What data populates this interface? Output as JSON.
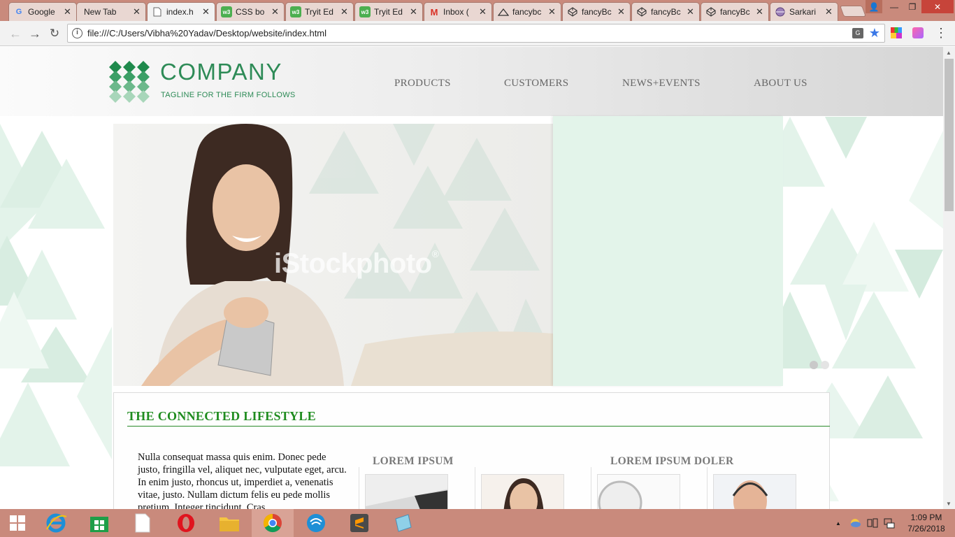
{
  "browser": {
    "tabs": [
      {
        "label": "Google",
        "icon": "google-icon"
      },
      {
        "label": "New Tab",
        "icon": ""
      },
      {
        "label": "index.h",
        "icon": "page-icon",
        "active": true
      },
      {
        "label": "CSS bo",
        "icon": "w3-icon"
      },
      {
        "label": "Tryit Ed",
        "icon": "w3-icon"
      },
      {
        "label": "Tryit Ed",
        "icon": "w3-icon"
      },
      {
        "label": "Inbox (",
        "icon": "gmail-icon"
      },
      {
        "label": "fancybc",
        "icon": "triangle-icon"
      },
      {
        "label": "fancyBc",
        "icon": "codepen-icon"
      },
      {
        "label": "fancyBc",
        "icon": "codepen-icon"
      },
      {
        "label": "fancyBc",
        "icon": "codepen-icon"
      },
      {
        "label": "Sarkari",
        "icon": "globe-icon"
      }
    ],
    "close_glyph": "✕",
    "url": "file:///C:/Users/Vibha%20Yadav/Desktop/website/index.html",
    "translate_glyph": "G",
    "star_glyph": "★",
    "menu_glyph": "⋮",
    "back_glyph": "←",
    "forward_glyph": "→",
    "reload_glyph": "↻",
    "info_glyph": "i",
    "window": {
      "user_glyph": "👤",
      "min_glyph": "—",
      "max_glyph": "❐",
      "close_glyph": "✕"
    }
  },
  "site": {
    "logo": {
      "name": "COMPANY",
      "tagline": "TAGLINE FOR THE FIRM FOLLOWS"
    },
    "nav": [
      "PRODUCTS",
      "CUSTOMERS",
      "NEWS+EVENTS",
      "ABOUT US"
    ],
    "hero": {
      "watermark": "iStockphoto",
      "watermark_mark": "®",
      "slider_dots": 2,
      "active_dot": 0
    },
    "section": {
      "title": "THE CONNECTED LIFESTYLE",
      "paragraph": "Nulla consequat massa quis enim. Donec pede justo, fringilla vel, aliquet nec, vulputate eget, arcu. In enim justo, rhoncus ut, imperdiet a, venenatis vitae, justo. Nullam dictum felis eu pede mollis pretium. Integer tincidunt. Cras",
      "col1_heading": "LOREM IPSUM",
      "col2_heading": "LOREM IPSUM DOLER"
    }
  },
  "taskbar": {
    "apps": [
      "start-button",
      "internet-explorer-icon",
      "store-icon",
      "file-icon",
      "opera-icon",
      "file-explorer-icon",
      "chrome-icon",
      "network-app-icon",
      "sublime-text-icon",
      "notepad-icon"
    ],
    "tray_up_glyph": "▲",
    "time": "1:09 PM",
    "date": "7/26/2018"
  },
  "colors": {
    "brand_green": "#2e8b57",
    "title_green": "#1f8c1f",
    "hero_side": "#e3f4ea",
    "taskbar": "#c98a7c"
  }
}
